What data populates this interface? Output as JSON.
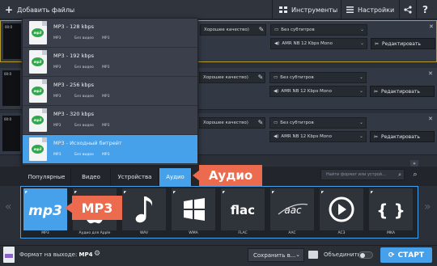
{
  "toolbar": {
    "add_files": "Добавить файлы",
    "add_icon": "+",
    "tools": "Инструменты",
    "settings": "Настройки"
  },
  "rows": [
    {
      "time": "00:0",
      "quality": "Хорошее качество)",
      "subtitles": "Без субтитров",
      "audio": "AMR NB 12 Kbps Mono",
      "edit": "Редактировать"
    },
    {
      "time": "00:0",
      "quality": "Хорошее качество)",
      "subtitles": "Без субтитров",
      "audio": "AMR NB 12 Kbps Mono",
      "edit": "Редактировать"
    },
    {
      "time": "00:0",
      "quality": "Хорошее качество)",
      "subtitles": "Без субтитров",
      "audio": "AMR NB 12 Kbps Mono",
      "edit": "Редактировать"
    }
  ],
  "dropdown": {
    "icon_text": "mp3",
    "items": [
      {
        "title": "MP3 - 128 kbps",
        "sub1": "MP3",
        "sub2": "Без видео",
        "sub3": "MP3"
      },
      {
        "title": "MP3 - 192 kbps",
        "sub1": "MP3",
        "sub2": "Без видео",
        "sub3": "MP3"
      },
      {
        "title": "MP3 - 256 kbps",
        "sub1": "MP3",
        "sub2": "Без видео",
        "sub3": "MP3"
      },
      {
        "title": "MP3 - 320 kbps",
        "sub1": "MP3",
        "sub2": "Без видео",
        "sub3": "MP3"
      },
      {
        "title": "MP3 - Исходный битрейт",
        "sub1": "MP3",
        "sub2": "Без видео",
        "sub3": "MP3"
      }
    ]
  },
  "tabs": [
    "Популярные",
    "Видео",
    "Устройства",
    "Аудио"
  ],
  "search_placeholder": "Найти формат или устрой...",
  "formats": [
    {
      "label": "MP3",
      "glyph": "mp3"
    },
    {
      "label": "Аудио для Apple",
      "glyph": ""
    },
    {
      "label": "WAV",
      "glyph": "♪"
    },
    {
      "label": "WMA",
      "glyph": ""
    },
    {
      "label": "FLAC",
      "glyph": "flac"
    },
    {
      "label": "AAC",
      "glyph": "aac"
    },
    {
      "label": "AC3",
      "glyph": ""
    },
    {
      "label": "MKA",
      "glyph": "{ }"
    }
  ],
  "callouts": {
    "audio": "Аудио",
    "mp3": "MP3"
  },
  "footer": {
    "output_label": "Формат на выходе:",
    "output_value": "MP4",
    "save": "Сохранить в...",
    "merge": "Объединить:",
    "start": "СТАРТ"
  },
  "colors": {
    "accent": "#47a1ea",
    "callout": "#ec6a4d",
    "selected_border": "#b59d2c"
  }
}
